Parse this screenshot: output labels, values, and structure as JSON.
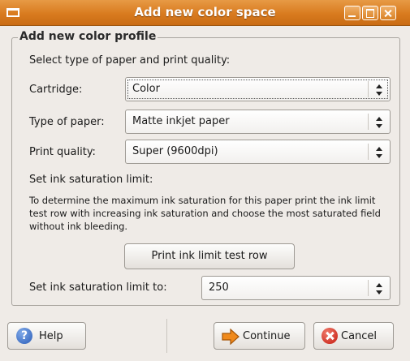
{
  "window": {
    "title": "Add new color space"
  },
  "profile_frame": {
    "legend": "Add new color profile",
    "select_heading": "Select type of paper and print quality:",
    "cartridge_label": "Cartridge:",
    "cartridge_value": "Color",
    "paper_label": "Type of paper:",
    "paper_value": "Matte inkjet paper",
    "quality_label": "Print quality:",
    "quality_value": "Super (9600dpi)",
    "ink_heading": "Set ink saturation limit:",
    "description": "To determine the maximum ink saturation for this paper print the ink limit test row with increasing ink saturation and choose the most saturated field without ink bleeding.",
    "test_button": "Print ink limit test row",
    "limit_label": "Set ink saturation limit to:",
    "limit_value": "250"
  },
  "buttons": {
    "help": "Help",
    "continue": "Continue",
    "cancel": "Cancel"
  },
  "icons": {
    "help": "help-question-icon",
    "continue": "arrow-right-icon",
    "cancel": "cancel-x-icon"
  },
  "colors": {
    "titlebar": "#d97b1f",
    "window_bg": "#efebe7",
    "help_icon": "#2a5db8",
    "continue_icon": "#f08a1c",
    "cancel_icon": "#c41b10"
  }
}
